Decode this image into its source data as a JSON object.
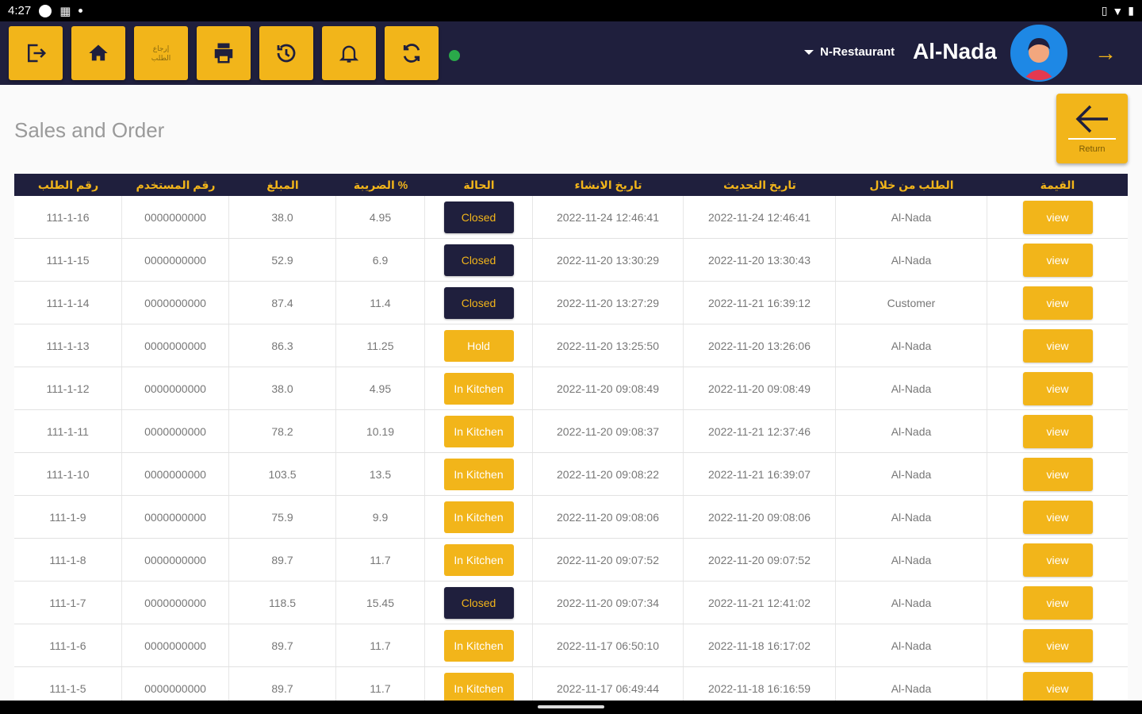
{
  "status_bar": {
    "time": "4:27",
    "icons": [
      "circle-icon",
      "notification-icon",
      "dot-icon"
    ],
    "right_icons": [
      "vibrate-icon",
      "wifi-icon",
      "battery-icon"
    ]
  },
  "header": {
    "buttons": [
      {
        "name": "logout",
        "icon": "logout-icon"
      },
      {
        "name": "home",
        "icon": "home-icon"
      },
      {
        "name": "return-order",
        "icon": "text",
        "label_line1": "إرجاع",
        "label_line2": "الطلب"
      },
      {
        "name": "print",
        "icon": "printer-icon"
      },
      {
        "name": "history",
        "icon": "history-icon"
      },
      {
        "name": "notifications",
        "icon": "bell-icon"
      },
      {
        "name": "sync",
        "icon": "sync-icon"
      }
    ],
    "online_status_color": "#2aa94a",
    "restaurant": "N-Restaurant",
    "user_name": "Al-Nada"
  },
  "page": {
    "title": "Sales and Order",
    "return_label": "Return"
  },
  "table": {
    "headers": [
      "رقم الطلب",
      "رقم المستخدم",
      "المبلغ",
      "الضريبة %",
      "الحالة",
      "تاريخ الانشاء",
      "تاريخ التحديث",
      "الطلب من خلال",
      "القيمة"
    ],
    "rows": [
      {
        "order": "111-1-16",
        "user": "0000000000",
        "amount": "38.0",
        "tax": "4.95",
        "status": "Closed",
        "created": "2022-11-24 12:46:41",
        "updated": "2022-11-24 12:46:41",
        "via": "Al-Nada",
        "action": "view"
      },
      {
        "order": "111-1-15",
        "user": "0000000000",
        "amount": "52.9",
        "tax": "6.9",
        "status": "Closed",
        "created": "2022-11-20 13:30:29",
        "updated": "2022-11-20 13:30:43",
        "via": "Al-Nada",
        "action": "view"
      },
      {
        "order": "111-1-14",
        "user": "0000000000",
        "amount": "87.4",
        "tax": "11.4",
        "status": "Closed",
        "created": "2022-11-20 13:27:29",
        "updated": "2022-11-21 16:39:12",
        "via": "Customer",
        "action": "view"
      },
      {
        "order": "111-1-13",
        "user": "0000000000",
        "amount": "86.3",
        "tax": "11.25",
        "status": "Hold",
        "created": "2022-11-20 13:25:50",
        "updated": "2022-11-20 13:26:06",
        "via": "Al-Nada",
        "action": "view"
      },
      {
        "order": "111-1-12",
        "user": "0000000000",
        "amount": "38.0",
        "tax": "4.95",
        "status": "In Kitchen",
        "created": "2022-11-20 09:08:49",
        "updated": "2022-11-20 09:08:49",
        "via": "Al-Nada",
        "action": "view"
      },
      {
        "order": "111-1-11",
        "user": "0000000000",
        "amount": "78.2",
        "tax": "10.19",
        "status": "In Kitchen",
        "created": "2022-11-20 09:08:37",
        "updated": "2022-11-21 12:37:46",
        "via": "Al-Nada",
        "action": "view"
      },
      {
        "order": "111-1-10",
        "user": "0000000000",
        "amount": "103.5",
        "tax": "13.5",
        "status": "In Kitchen",
        "created": "2022-11-20 09:08:22",
        "updated": "2022-11-21 16:39:07",
        "via": "Al-Nada",
        "action": "view"
      },
      {
        "order": "111-1-9",
        "user": "0000000000",
        "amount": "75.9",
        "tax": "9.9",
        "status": "In Kitchen",
        "created": "2022-11-20 09:08:06",
        "updated": "2022-11-20 09:08:06",
        "via": "Al-Nada",
        "action": "view"
      },
      {
        "order": "111-1-8",
        "user": "0000000000",
        "amount": "89.7",
        "tax": "11.7",
        "status": "In Kitchen",
        "created": "2022-11-20 09:07:52",
        "updated": "2022-11-20 09:07:52",
        "via": "Al-Nada",
        "action": "view"
      },
      {
        "order": "111-1-7",
        "user": "0000000000",
        "amount": "118.5",
        "tax": "15.45",
        "status": "Closed",
        "created": "2022-11-20 09:07:34",
        "updated": "2022-11-21 12:41:02",
        "via": "Al-Nada",
        "action": "view"
      },
      {
        "order": "111-1-6",
        "user": "0000000000",
        "amount": "89.7",
        "tax": "11.7",
        "status": "In Kitchen",
        "created": "2022-11-17 06:50:10",
        "updated": "2022-11-18 16:17:02",
        "via": "Al-Nada",
        "action": "view"
      },
      {
        "order": "111-1-5",
        "user": "0000000000",
        "amount": "89.7",
        "tax": "11.7",
        "status": "In Kitchen",
        "created": "2022-11-17 06:49:44",
        "updated": "2022-11-18 16:16:59",
        "via": "Al-Nada",
        "action": "view"
      }
    ]
  },
  "colors": {
    "primary": "#1f1f3d",
    "accent": "#f2b51a",
    "online": "#2aa94a"
  }
}
